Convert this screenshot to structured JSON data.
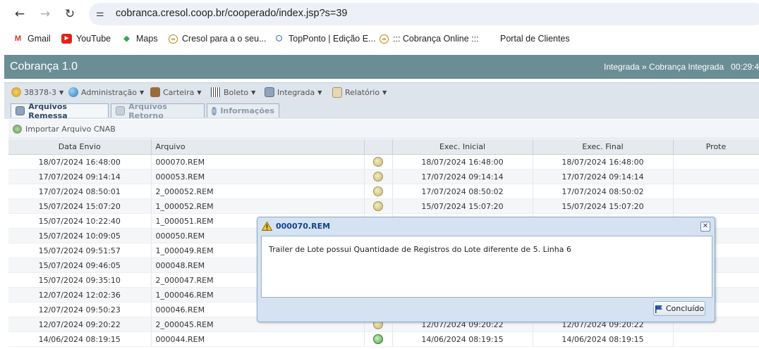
{
  "browser": {
    "url": "cobranca.cresol.coop.br/cooperado/index.jsp?s=39",
    "bookmarks": [
      {
        "label": "Gmail",
        "icon": "gmail-icon"
      },
      {
        "label": "YouTube",
        "icon": "youtube-icon"
      },
      {
        "label": "Maps",
        "icon": "maps-icon"
      },
      {
        "label": "Cresol para a o seu...",
        "icon": "cresol-icon"
      },
      {
        "label": "TopPonto | Edição E...",
        "icon": "topponto-icon"
      },
      {
        "label": "::: Cobrança Online :::",
        "icon": "cresol-icon"
      },
      {
        "label": "Portal de Clientes",
        "icon": ""
      }
    ]
  },
  "app": {
    "title": "Cobrança 1.0",
    "breadcrumb": "Integrada » Cobrança Integrada",
    "clock": "00:29:4"
  },
  "menu": [
    {
      "label": "38378-3",
      "icon": "account-icon"
    },
    {
      "label": "Administração",
      "icon": "globe-icon"
    },
    {
      "label": "Carteira",
      "icon": "wallet-icon"
    },
    {
      "label": "Boleto",
      "icon": "barcode-icon"
    },
    {
      "label": "Integrada",
      "icon": "integrated-icon"
    },
    {
      "label": "Relatório",
      "icon": "report-icon"
    }
  ],
  "tabs": [
    {
      "label": "Arquivos Remessa",
      "active": true
    },
    {
      "label": "Arquivos Retorno",
      "active": false
    },
    {
      "label": "Informações",
      "active": false
    }
  ],
  "toolbar": {
    "import_label": "Importar Arquivo CNAB"
  },
  "grid": {
    "columns": [
      "Data Envio",
      "Arquivo",
      "",
      "Exec. Inicial",
      "Exec. Final",
      "Prote"
    ],
    "rows": [
      {
        "envio": "18/07/2024 16:48:00",
        "arquivo": "000070.REM",
        "status": "warning",
        "inicial": "18/07/2024 16:48:00",
        "final": "18/07/2024 16:48:00"
      },
      {
        "envio": "17/07/2024 09:14:14",
        "arquivo": "000053.REM",
        "status": "warning",
        "inicial": "17/07/2024 09:14:14",
        "final": "17/07/2024 09:14:14"
      },
      {
        "envio": "17/07/2024 08:50:01",
        "arquivo": "2_000052.REM",
        "status": "warning",
        "inicial": "17/07/2024 08:50:02",
        "final": "17/07/2024 08:50:02"
      },
      {
        "envio": "15/07/2024 15:07:20",
        "arquivo": "1_000052.REM",
        "status": "warning",
        "inicial": "15/07/2024 15:07:20",
        "final": "15/07/2024 15:07:20"
      },
      {
        "envio": "15/07/2024 10:22:40",
        "arquivo": "1_000051.REM",
        "status": "",
        "inicial": "",
        "final": ""
      },
      {
        "envio": "15/07/2024 10:09:05",
        "arquivo": "000050.REM",
        "status": "",
        "inicial": "",
        "final": ""
      },
      {
        "envio": "15/07/2024 09:51:57",
        "arquivo": "1_000049.REM",
        "status": "",
        "inicial": "",
        "final": ""
      },
      {
        "envio": "15/07/2024 09:46:05",
        "arquivo": "000048.REM",
        "status": "",
        "inicial": "",
        "final": ""
      },
      {
        "envio": "15/07/2024 09:35:10",
        "arquivo": "2_000047.REM",
        "status": "",
        "inicial": "",
        "final": ""
      },
      {
        "envio": "12/07/2024 12:02:36",
        "arquivo": "1_000046.REM",
        "status": "",
        "inicial": "",
        "final": ""
      },
      {
        "envio": "12/07/2024 09:50:23",
        "arquivo": "000046.REM",
        "status": "",
        "inicial": "",
        "final": ""
      },
      {
        "envio": "12/07/2024 09:20:22",
        "arquivo": "2_000045.REM",
        "status": "warning",
        "inicial": "12/07/2024 09:20:22",
        "final": "12/07/2024 09:20:22"
      },
      {
        "envio": "14/06/2024 08:19:15",
        "arquivo": "000044.REM",
        "status": "ok",
        "inicial": "14/06/2024 08:19:15",
        "final": "14/06/2024 08:19:15"
      }
    ]
  },
  "dialog": {
    "title": "000070.REM",
    "message": "Trailer de Lote possui Quantidade de Registros do Lote diferente de 5. Linha 6",
    "close_symbol": "✕",
    "button_label": "Concluído"
  }
}
